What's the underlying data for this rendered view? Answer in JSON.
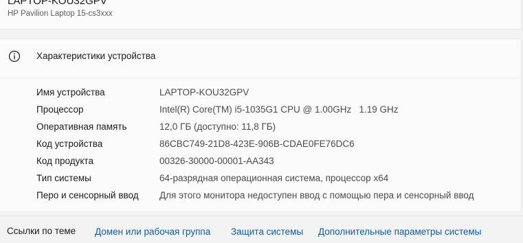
{
  "device": {
    "name": "LAPTOP-KOU32GPV",
    "model": "HP Pavilion Laptop 15-cs3xxx"
  },
  "specs": {
    "title": "Характеристики устройства",
    "icon": "info-icon",
    "rows": [
      {
        "label": "Имя устройства",
        "value": "LAPTOP-KOU32GPV"
      },
      {
        "label": "Процессор",
        "value": "Intel(R) Core(TM) i5-1035G1 CPU @ 1.00GHz   1.19 GHz"
      },
      {
        "label": "Оперативная память",
        "value": "12,0 ГБ (доступно: 11,8 ГБ)"
      },
      {
        "label": "Код устройства",
        "value": "86CBC749-21D8-423E-906B-CDAE0FE76DC6"
      },
      {
        "label": "Код продукта",
        "value": "00326-30000-00001-AA343"
      },
      {
        "label": "Тип системы",
        "value": "64-разрядная операционная система, процессор x64"
      },
      {
        "label": "Перо и сенсорный ввод",
        "value": "Для этого монитора недоступен ввод с помощью пера и сенсорный ввод"
      }
    ]
  },
  "related_links": {
    "title": "Ссылки по теме",
    "links": [
      "Домен или рабочая группа",
      "Защита системы",
      "Дополнительные параметры системы"
    ]
  },
  "colors": {
    "link": "#0f5b9c",
    "card_background": "#fbfbfb",
    "page_background": "#f3f3f3"
  }
}
